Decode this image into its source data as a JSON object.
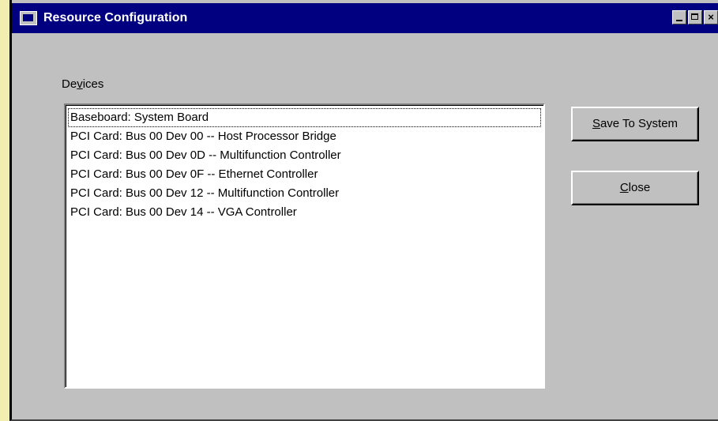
{
  "window": {
    "title": "Resource Configuration",
    "buttons": {
      "minimize": "",
      "maximize": "",
      "close": "×"
    }
  },
  "devices": {
    "label_prefix": "De",
    "label_mnemonic": "v",
    "label_suffix": "ices",
    "items": [
      "Baseboard: System Board",
      "PCI Card: Bus 00 Dev 00 -- Host Processor Bridge",
      "PCI Card: Bus 00 Dev 0D -- Multifunction Controller",
      "PCI Card: Bus 00 Dev 0F -- Ethernet Controller",
      "PCI Card: Bus 00 Dev 12 -- Multifunction Controller",
      "PCI Card: Bus 00 Dev 14 -- VGA Controller"
    ],
    "focused_index": 0
  },
  "actions": {
    "save": {
      "mnemonic": "S",
      "rest": "ave To System"
    },
    "close": {
      "mnemonic": "C",
      "rest": "lose"
    }
  },
  "colors": {
    "titlebar": "#000080",
    "face": "#c0c0c0",
    "list_bg": "#ffffff"
  }
}
